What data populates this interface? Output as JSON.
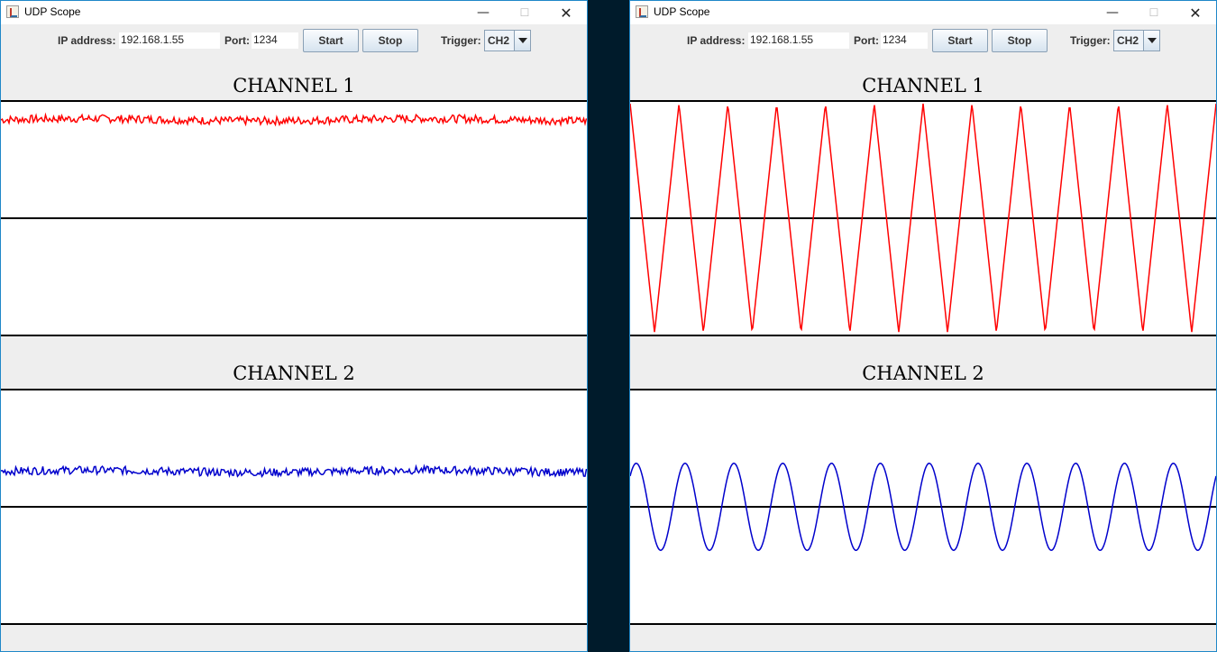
{
  "windows": [
    {
      "title": "UDP Scope",
      "toolbar": {
        "ip_label": "IP address:",
        "ip_value": "192.168.1.55",
        "port_label": "Port:",
        "port_value": "1234",
        "start_label": "Start",
        "stop_label": "Stop",
        "trigger_label": "Trigger:",
        "trigger_value": "CH2"
      },
      "channels": [
        {
          "title": "CHANNEL 1",
          "color": "#ff0000",
          "signal": "noise",
          "level": 0.86,
          "noise": 0.035
        },
        {
          "title": "CHANNEL 2",
          "color": "#0000cc",
          "signal": "noise",
          "level": 0.31,
          "noise": 0.035
        }
      ]
    },
    {
      "title": "UDP Scope",
      "toolbar": {
        "ip_label": "IP address:",
        "ip_value": "192.168.1.55",
        "port_label": "Port:",
        "port_value": "1234",
        "start_label": "Start",
        "stop_label": "Stop",
        "trigger_label": "Trigger:",
        "trigger_value": "CH2"
      },
      "channels": [
        {
          "title": "CHANNEL 1",
          "color": "#ff0000",
          "signal": "triangle",
          "periods": 12,
          "amplitude": 1.0
        },
        {
          "title": "CHANNEL 2",
          "color": "#0000cc",
          "signal": "sine",
          "periods": 12,
          "amplitude": 0.38
        }
      ]
    }
  ]
}
